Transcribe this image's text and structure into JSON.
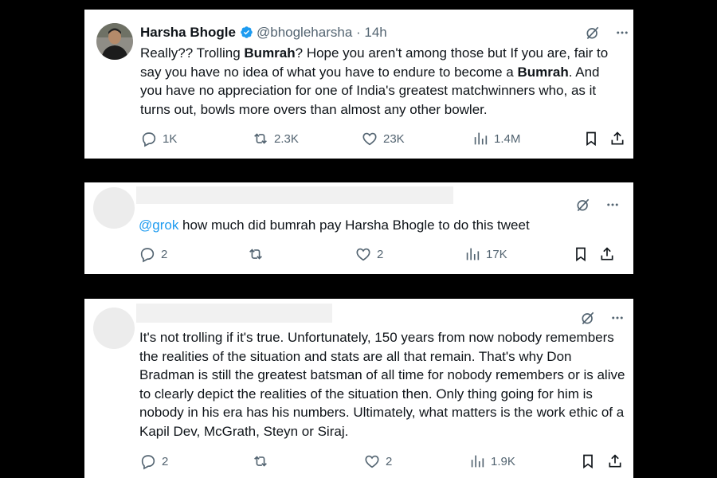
{
  "tweets": [
    {
      "author": {
        "name": "Harsha Bhogle",
        "handle": "@bhogleharsha",
        "time": "14h"
      },
      "text_parts": [
        {
          "t": "Really?? Trolling ",
          "b": false
        },
        {
          "t": "Bumrah",
          "b": true
        },
        {
          "t": "? Hope you aren't among those but If you are, fair to say you have no idea of what you have to endure to become a ",
          "b": false
        },
        {
          "t": "Bumrah",
          "b": true
        },
        {
          "t": ". And you have no appreciation for one of India's greatest matchwinners who, as it turns out, bowls more overs than almost any other bowler.",
          "b": false
        }
      ],
      "actions": {
        "replies": "1K",
        "reposts": "2.3K",
        "likes": "23K",
        "views": "1.4M"
      }
    },
    {
      "mention": "@grok",
      "text": " how much did bumrah pay Harsha Bhogle to do this tweet",
      "actions": {
        "replies": "2",
        "reposts": "",
        "likes": "2",
        "views": "17K"
      }
    },
    {
      "text": "It's not trolling if it's true. Unfortunately, 150 years from now nobody remembers the realities of the situation and stats are all that remain. That's why Don Bradman is still the greatest batsman of all time for nobody remembers or is alive to clearly depict the realities of the situation then. Only thing going for him is nobody in his era has his numbers. Ultimately, what matters is the work ethic of a Kapil Dev, McGrath, Steyn or Siraj.",
      "actions": {
        "replies": "2",
        "reposts": "",
        "likes": "2",
        "views": "1.9K"
      }
    }
  ],
  "colors": {
    "text": "#0f1419",
    "muted": "#536471",
    "link": "#1d9bf0",
    "verified": "#1d9bf0"
  },
  "icons": [
    "grok-icon",
    "more-icon",
    "reply-icon",
    "repost-icon",
    "like-icon",
    "views-icon",
    "bookmark-icon",
    "share-icon",
    "verified-badge-icon"
  ]
}
